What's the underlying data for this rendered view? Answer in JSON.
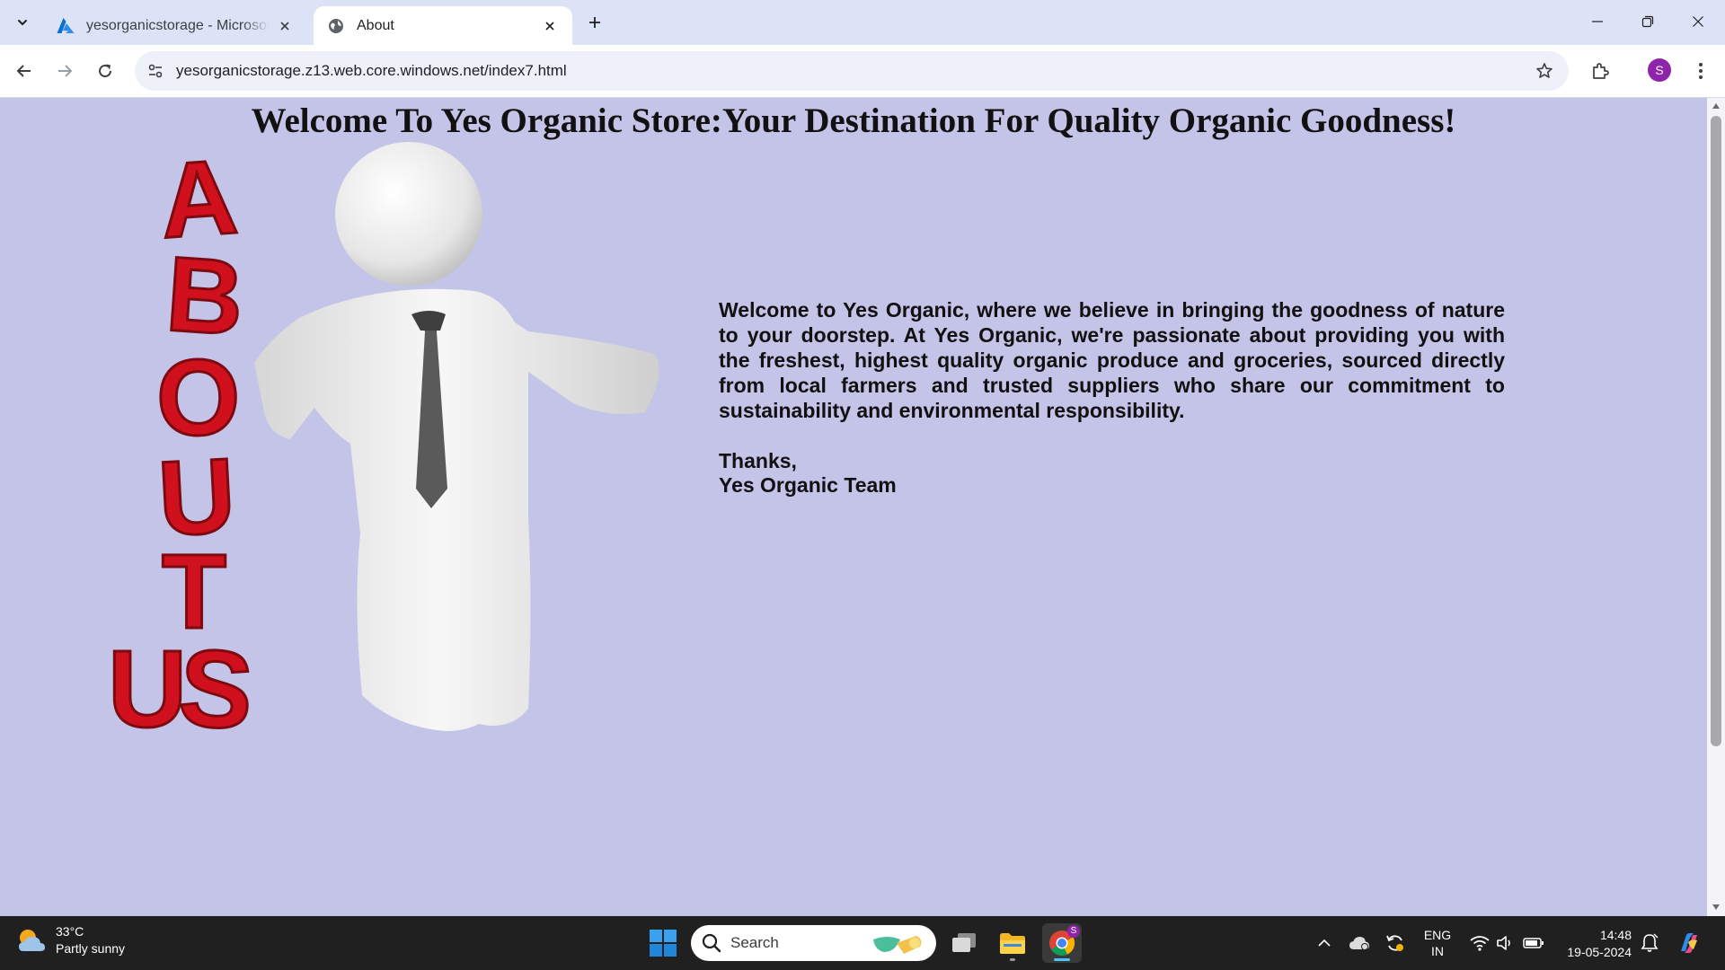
{
  "browser": {
    "tabs": [
      {
        "title": "yesorganicstorage - Microsoft Azure",
        "active": false
      },
      {
        "title": "About",
        "active": true
      }
    ],
    "url": "yesorganicstorage.z13.web.core.windows.net/index7.html",
    "profile_initial": "S"
  },
  "page": {
    "title": "Welcome To Yes Organic Store:Your Destination For Quality Organic Goodness!",
    "image_text": "ABOUT US",
    "paragraph": "Welcome to Yes Organic, where we believe in bringing the goodness of nature to your doorstep. At Yes Organic, we're passionate about providing you with the freshest, highest quality organic produce and groceries, sourced directly from local farmers and trusted suppliers who share our commitment to sustainability and environmental responsibility.",
    "sign_thanks": "Thanks,",
    "sign_team": "Yes Organic Team"
  },
  "taskbar": {
    "weather": {
      "temp": "33°C",
      "condition": "Partly sunny"
    },
    "search_placeholder": "Search",
    "chrome_badge": "S",
    "language": {
      "line1": "ENG",
      "line2": "IN"
    },
    "time": "14:48",
    "date": "19-05-2024"
  },
  "colors": {
    "page_background": "#c4c3e8",
    "about_letters": "#d0101c",
    "tab_strip": "#dce3f7",
    "taskbar": "#202020"
  }
}
